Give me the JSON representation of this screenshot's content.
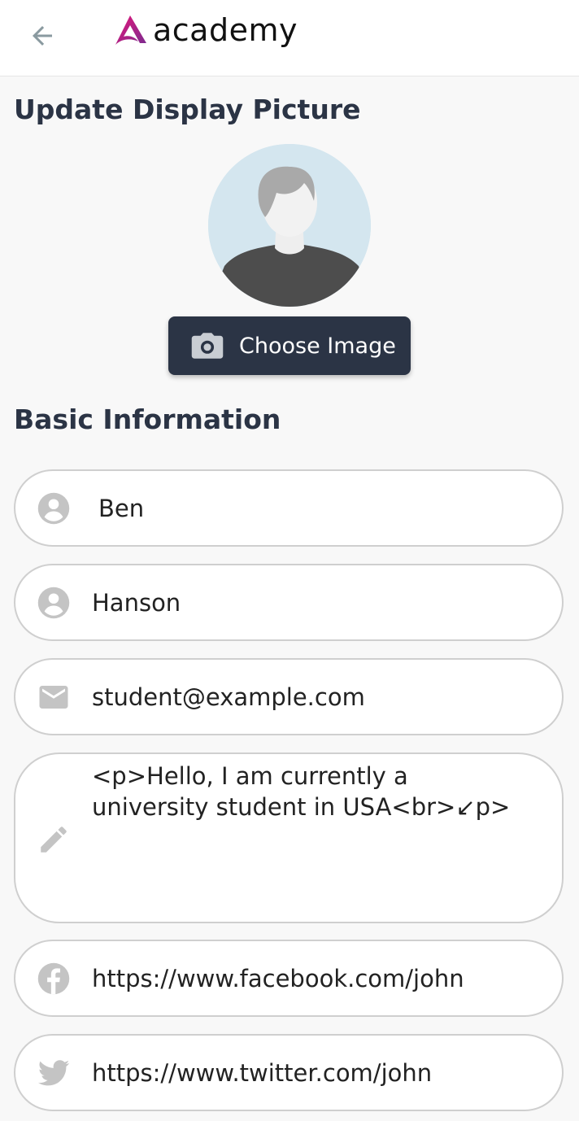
{
  "header": {
    "back_icon": "arrow-back-icon",
    "brand_name": "academy",
    "brand_colors": [
      "#e5177a",
      "#7b2a8f"
    ]
  },
  "display_picture": {
    "title": "Update Display Picture",
    "avatar_icon": "default-avatar",
    "choose_button": {
      "label": "Choose Image",
      "icon": "camera-icon"
    }
  },
  "basic_info": {
    "title": "Basic Information",
    "fields": {
      "first_name": {
        "value": "Ben",
        "icon": "person-icon"
      },
      "last_name": {
        "value": "Hanson",
        "icon": "person-icon"
      },
      "email": {
        "value": "student@example.com",
        "icon": "mail-icon"
      },
      "biography": {
        "value": "<p>Hello, I am currently a university student in USA<br>↙p>",
        "icon": "pencil-icon"
      },
      "facebook": {
        "value": "https://www.facebook.com/john",
        "icon": "facebook-icon"
      },
      "twitter": {
        "value": "https://www.twitter.com/john",
        "icon": "twitter-icon"
      }
    }
  },
  "colors": {
    "primary": "#2b3445",
    "background": "#f8f8f8",
    "field_border": "#cfcfcf",
    "icon_grey": "#c4c4c4"
  }
}
